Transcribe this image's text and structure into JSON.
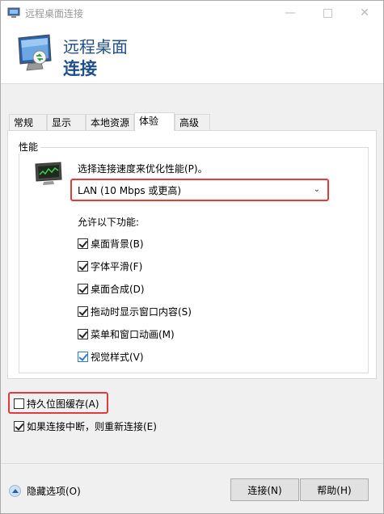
{
  "window": {
    "title": "远程桌面连接"
  },
  "header": {
    "line1": "远程桌面",
    "line2": "连接"
  },
  "tabs": [
    {
      "label": "常规",
      "active": false
    },
    {
      "label": "显示",
      "active": false
    },
    {
      "label": "本地资源",
      "active": false
    },
    {
      "label": "体验",
      "active": true
    },
    {
      "label": "高级",
      "active": false
    }
  ],
  "performance": {
    "group_label": "性能",
    "choose_label": "选择连接速度来优化性能(P)。",
    "speed_selected": "LAN (10 Mbps 或更高)",
    "allow_label": "允许以下功能:",
    "features": [
      {
        "label": "桌面背景(B)",
        "checked": true
      },
      {
        "label": "字体平滑(F)",
        "checked": true
      },
      {
        "label": "桌面合成(D)",
        "checked": true
      },
      {
        "label": "拖动时显示窗口内容(S)",
        "checked": true
      },
      {
        "label": "菜单和窗口动画(M)",
        "checked": true
      },
      {
        "label": "视觉样式(V)",
        "checked": true
      }
    ]
  },
  "options": {
    "persistent_bitmap": {
      "label": "持久位图缓存(A)",
      "checked": false
    },
    "reconnect": {
      "label": "如果连接中断，则重新连接(E)",
      "checked": true
    }
  },
  "footer": {
    "hide_options": "隐藏选项(O)",
    "connect": "连接(N)",
    "help": "帮助(H)"
  },
  "colors": {
    "highlight": "#e23b3b",
    "header_text": "#1f4e8c"
  },
  "icons": {
    "title": "remote-desktop-icon",
    "header": "remote-desktop-monitor-icon",
    "performance": "performance-monitor-icon",
    "hide": "collapse-up-icon"
  }
}
